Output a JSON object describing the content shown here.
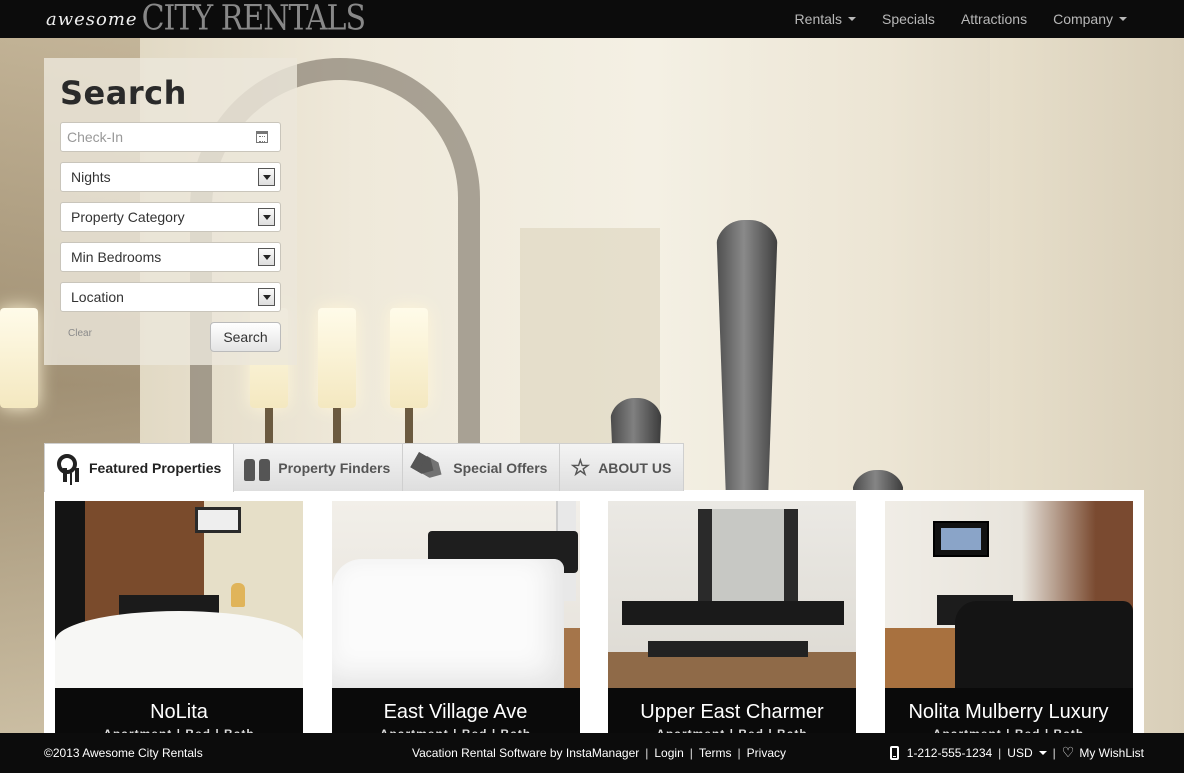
{
  "header": {
    "logo_small": "awesome",
    "logo_big": "CITY RENTALS",
    "nav": [
      {
        "label": "Rentals",
        "dropdown": true
      },
      {
        "label": "Specials",
        "dropdown": false
      },
      {
        "label": "Attractions",
        "dropdown": false
      },
      {
        "label": "Company",
        "dropdown": true
      }
    ]
  },
  "search": {
    "title": "Search",
    "checkin_placeholder": "Check-In",
    "nights": "Nights",
    "property_category": "Property Category",
    "min_bedrooms": "Min Bedrooms",
    "location": "Location",
    "clear_label": "Clear",
    "search_label": "Search"
  },
  "tabs": [
    {
      "label": "Featured Properties",
      "icon": "keys-icon",
      "active": true
    },
    {
      "label": "Property Finders",
      "icon": "binoculars-icon",
      "active": false
    },
    {
      "label": "Special Offers",
      "icon": "tags-icon",
      "active": false
    },
    {
      "label": "ABOUT US",
      "icon": "star-icon",
      "active": false
    }
  ],
  "properties": [
    {
      "name": "NoLita",
      "sub": "Apartment | Bed | Bath"
    },
    {
      "name": "East Village Ave",
      "sub": "Apartment | Bed | Bath"
    },
    {
      "name": "Upper East Charmer",
      "sub": "Apartment | Bed | Bath"
    },
    {
      "name": "Nolita Mulberry Luxury",
      "sub": "Apartment | Bed | Bath"
    }
  ],
  "footer": {
    "copyright": "©2013 Awesome City Rentals",
    "software": "Vacation Rental Software by InstaManager",
    "login": "Login",
    "terms": "Terms",
    "privacy": "Privacy",
    "phone": "1-212-555-1234",
    "currency": "USD",
    "wishlist": "My WishList"
  }
}
